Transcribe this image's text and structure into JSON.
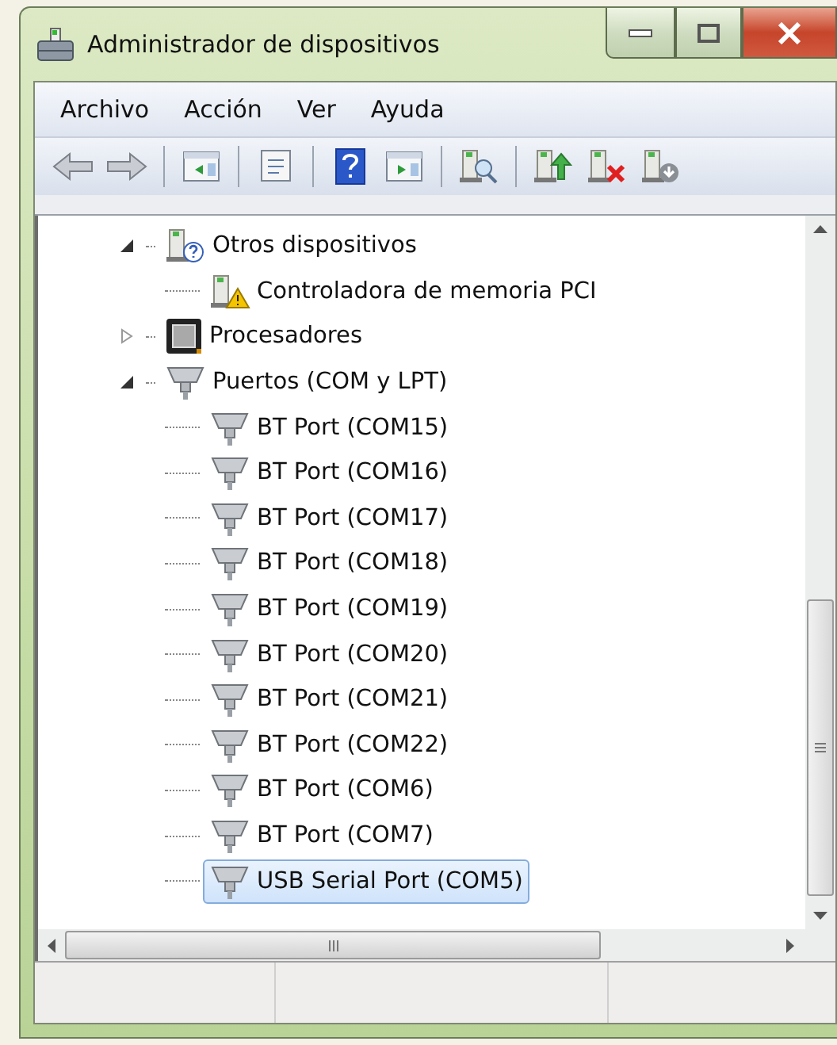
{
  "window": {
    "title": "Administrador de dispositivos"
  },
  "menu": [
    "Archivo",
    "Acción",
    "Ver",
    "Ayuda"
  ],
  "toolbar": [
    {
      "kind": "back"
    },
    {
      "kind": "forward"
    },
    {
      "kind": "sep"
    },
    {
      "kind": "pane"
    },
    {
      "kind": "sep"
    },
    {
      "kind": "props"
    },
    {
      "kind": "sep"
    },
    {
      "kind": "help"
    },
    {
      "kind": "pane2"
    },
    {
      "kind": "sep"
    },
    {
      "kind": "scan"
    },
    {
      "kind": "sep"
    },
    {
      "kind": "update"
    },
    {
      "kind": "uninstall"
    },
    {
      "kind": "disable"
    }
  ],
  "tree": [
    {
      "label": "Otros dispositivos",
      "kind": "unknown",
      "expanded": true,
      "selected": false,
      "children": [
        {
          "label": "Controladora de memoria PCI",
          "kind": "warning",
          "selected": false
        }
      ]
    },
    {
      "label": "Procesadores",
      "kind": "cpu",
      "expanded": false,
      "selected": false
    },
    {
      "label": "Puertos (COM y LPT)",
      "kind": "port",
      "expanded": true,
      "selected": false,
      "children": [
        {
          "label": "BT Port (COM15)",
          "kind": "port",
          "selected": false
        },
        {
          "label": "BT Port (COM16)",
          "kind": "port",
          "selected": false
        },
        {
          "label": "BT Port (COM17)",
          "kind": "port",
          "selected": false
        },
        {
          "label": "BT Port (COM18)",
          "kind": "port",
          "selected": false
        },
        {
          "label": "BT Port (COM19)",
          "kind": "port",
          "selected": false
        },
        {
          "label": "BT Port (COM20)",
          "kind": "port",
          "selected": false
        },
        {
          "label": "BT Port (COM21)",
          "kind": "port",
          "selected": false
        },
        {
          "label": "BT Port (COM22)",
          "kind": "port",
          "selected": false
        },
        {
          "label": "BT Port (COM6)",
          "kind": "port",
          "selected": false
        },
        {
          "label": "BT Port (COM7)",
          "kind": "port",
          "selected": false
        },
        {
          "label": "USB Serial Port (COM5)",
          "kind": "port",
          "selected": true
        }
      ]
    }
  ]
}
